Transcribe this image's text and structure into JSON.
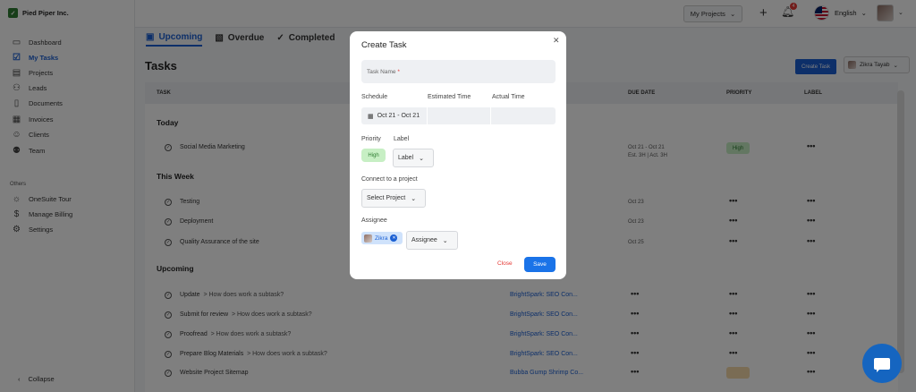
{
  "brand": {
    "name": "Pied Piper Inc.",
    "logo_letter": "✓"
  },
  "sidebar": {
    "items": [
      {
        "label": "Dashboard",
        "icon": "monitor-icon"
      },
      {
        "label": "My Tasks",
        "icon": "tasks-icon",
        "active": true
      },
      {
        "label": "Projects",
        "icon": "projects-icon"
      },
      {
        "label": "Leads",
        "icon": "leads-icon"
      },
      {
        "label": "Documents",
        "icon": "documents-icon"
      },
      {
        "label": "Invoices",
        "icon": "invoices-icon"
      },
      {
        "label": "Clients",
        "icon": "clients-icon"
      },
      {
        "label": "Team",
        "icon": "team-icon"
      }
    ],
    "others_label": "Others",
    "others": [
      {
        "label": "OneSuite Tour",
        "icon": "lightbulb-icon"
      },
      {
        "label": "Manage Billing",
        "icon": "dollar-icon"
      },
      {
        "label": "Settings",
        "icon": "gear-icon"
      }
    ],
    "collapse_label": "Collapse"
  },
  "topbar": {
    "project_select": "My Projects",
    "notification_count": "4",
    "language": "English"
  },
  "tabs": [
    {
      "label": "Upcoming",
      "icon": "calendar-icon",
      "active": true
    },
    {
      "label": "Overdue",
      "icon": "calendar-x-icon"
    },
    {
      "label": "Completed",
      "icon": "double-check-icon"
    }
  ],
  "page": {
    "title": "Tasks",
    "create_button": "Create Task",
    "assignee_filter": "Zikra Tayab"
  },
  "table": {
    "headers": {
      "task": "TASK",
      "due": "DUE DATE",
      "priority": "PRIORITY",
      "label": "LABEL"
    },
    "groups": {
      "today": "Today",
      "this_week": "This Week",
      "upcoming": "Upcoming"
    },
    "today_rows": [
      {
        "name": "Social Media Marketing",
        "due_line1": "Oct 21 - Oct 21",
        "due_line2": "Est. 3H | Act. 3H",
        "priority": "High",
        "label": "•••"
      }
    ],
    "week_rows": [
      {
        "name": "Testing",
        "due": "Oct 23",
        "priority": "•••",
        "label": "•••"
      },
      {
        "name": "Deployment",
        "due": "Oct 23",
        "priority": "•••",
        "label": "•••"
      },
      {
        "name": "Quality Assurance of the site",
        "due": "Oct 25",
        "priority": "•••",
        "label": "•••"
      }
    ],
    "upcoming_rows": [
      {
        "name": "Update",
        "sub": "> How does work a subtask?",
        "project": "BrightSpark: SEO Con...",
        "due": "•••",
        "priority": "•••",
        "label": "•••"
      },
      {
        "name": "Submit for review",
        "sub": "> How does work a subtask?",
        "project": "BrightSpark: SEO Con...",
        "due": "•••",
        "priority": "•••",
        "label": "•••"
      },
      {
        "name": "Proofread",
        "sub": "> How does work a subtask?",
        "project": "BrightSpark: SEO Con...",
        "due": "•••",
        "priority": "•••",
        "label": "•••"
      },
      {
        "name": "Prepare Blog Materials",
        "sub": "> How does work a subtask?",
        "project": "BrightSpark: SEO Con...",
        "due": "•••",
        "priority": "•••",
        "label": "•••"
      },
      {
        "name": "Website Project Sitemap",
        "sub": "",
        "project": "Bubba Gump Shrimp Co...",
        "due": "•••",
        "priority": "",
        "label": "•••"
      }
    ]
  },
  "modal": {
    "title": "Create Task",
    "task_name_placeholder": "Task Name",
    "required_mark": "*",
    "schedule_label": "Schedule",
    "estimated_label": "Estimated Time",
    "actual_label": "Actual Time",
    "schedule_value": "Oct 21 - Oct 21",
    "priority_label": "Priority",
    "priority_value": "High",
    "label_label": "Label",
    "label_select": "Label",
    "connect_label": "Connect to a project",
    "project_select": "Select Project",
    "assignee_label": "Assignee",
    "assignee_chip": "Zikra",
    "assignee_select": "Assignee",
    "close_label": "Close",
    "save_label": "Save"
  },
  "colors": {
    "accent": "#1a5fd3",
    "priority_high_bg": "#c7efc4",
    "priority_high_text": "#2e7d32",
    "danger": "#e53935"
  }
}
